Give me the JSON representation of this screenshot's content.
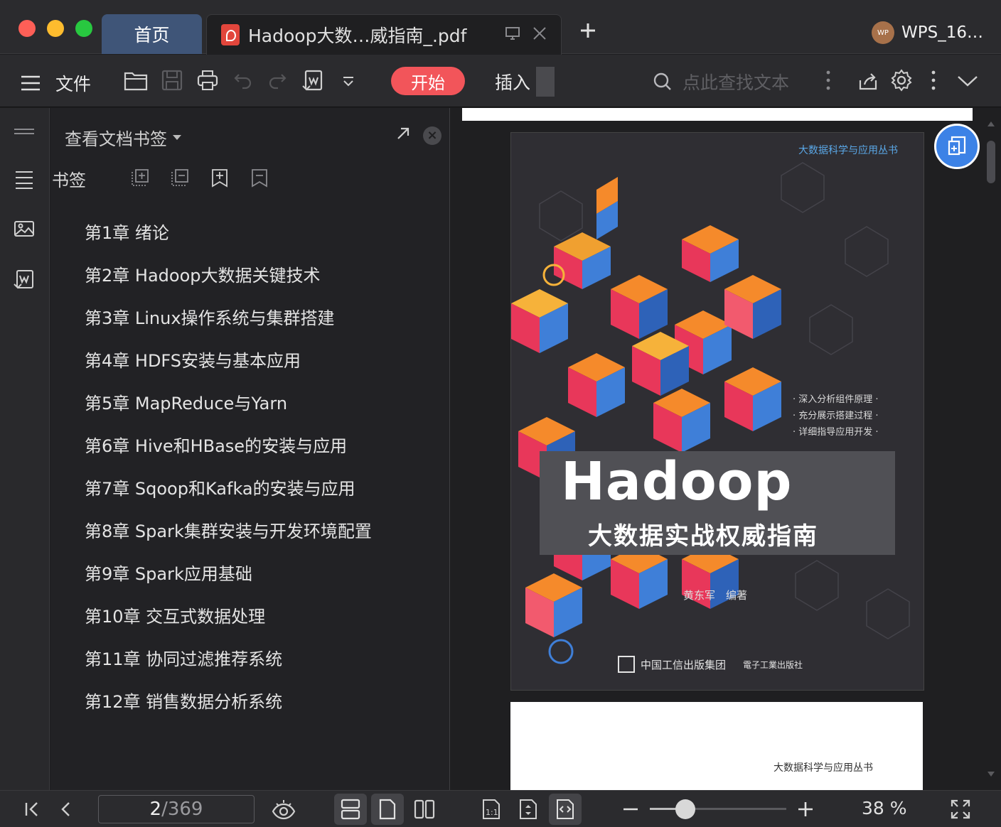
{
  "tabs": {
    "home_label": "首页",
    "doc_title": "Hadoop大数…威指南_.pdf"
  },
  "user": {
    "avatar_text": "WP",
    "name": "WPS_16…"
  },
  "toolbar": {
    "menu_label": "文件",
    "start_label": "开始",
    "insert_label": "插入",
    "search_placeholder": "点此查找文本"
  },
  "panel": {
    "title": "查看文档书签",
    "bookmarks_label": "书签",
    "items": [
      "第1章 绪论",
      "第2章 Hadoop大数据关键技术",
      "第3章 Linux操作系统与集群搭建",
      "第4章 HDFS安装与基本应用",
      "第5章 MapReduce与Yarn",
      "第6章 Hive和HBase的安装与应用",
      "第7章 Sqoop和Kafka的安装与应用",
      "第8章 Spark集群安装与开发环境配置",
      "第9章 Spark应用基础",
      "第10章 交互式数据处理",
      "第11章 协同过滤推荐系统",
      "第12章 销售数据分析系统"
    ]
  },
  "document": {
    "cover": {
      "series": "大数据科学与应用丛书",
      "bullets": [
        "· 深入分析组件原理 ·",
        "· 充分展示搭建过程 ·",
        "· 详细指导应用开发 ·"
      ],
      "title": "Hadoop",
      "subtitle": "大数据实战权威指南",
      "author": "黄东军　编著",
      "publisher1": "中国工信出版集团",
      "publisher2": "電子工業出版社"
    },
    "page2_series": "大数据科学与应用丛书"
  },
  "status": {
    "current_page": "2",
    "total_pages": "/369",
    "zoom_text": "38 %",
    "zoom_fraction": 0.26
  }
}
